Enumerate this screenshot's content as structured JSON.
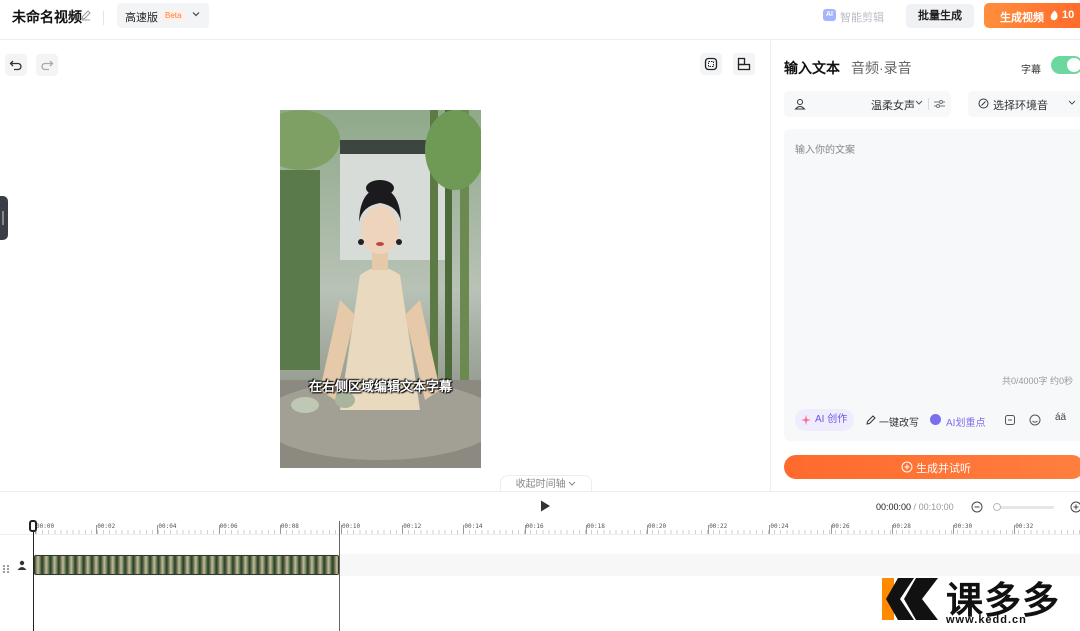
{
  "header": {
    "project_title": "未命名视频",
    "quality": {
      "label": "高速版",
      "badge": "Beta"
    },
    "smart_cut": {
      "ai_badge": "AI",
      "label": "智能剪辑"
    },
    "batch_label": "批量生成",
    "generate": {
      "label": "生成视频",
      "count": "10"
    }
  },
  "canvas": {
    "subtitle_text": "在右侧区域编辑文本字幕",
    "collapse_label": "收起时间轴"
  },
  "panel": {
    "tab_text": "输入文本",
    "tab_audio": "音频·录音",
    "subtitle_toggle": {
      "label": "字幕",
      "on": true
    },
    "voice": "温柔女声",
    "ambient": "选择环境音",
    "placeholder": "输入你的文案",
    "counter": "共0/4000字 约0秒",
    "tools": {
      "ai_create": "AI 创作",
      "one_key": "一键改写",
      "ai_mark": "AI划重点",
      "font_glyph": "áä"
    },
    "generate_listen": "生成并试听"
  },
  "timeline": {
    "current": "00:00:00",
    "separator": " / ",
    "total": "00:10:00",
    "ticks": [
      "00:00",
      "00:02",
      "00:04",
      "00:06",
      "00:08",
      "00:10",
      "00:12",
      "00:14",
      "00:16",
      "00:18",
      "00:20",
      "00:22",
      "00:24",
      "00:26",
      "00:28",
      "00:30",
      "00:32"
    ]
  },
  "watermark": {
    "brand": "课多多",
    "url": "www.kedd.cn"
  },
  "colors": {
    "accent": "#ff6a2b",
    "toggle_on": "#6cd8a0",
    "ai_purple": "#6b55e6"
  }
}
